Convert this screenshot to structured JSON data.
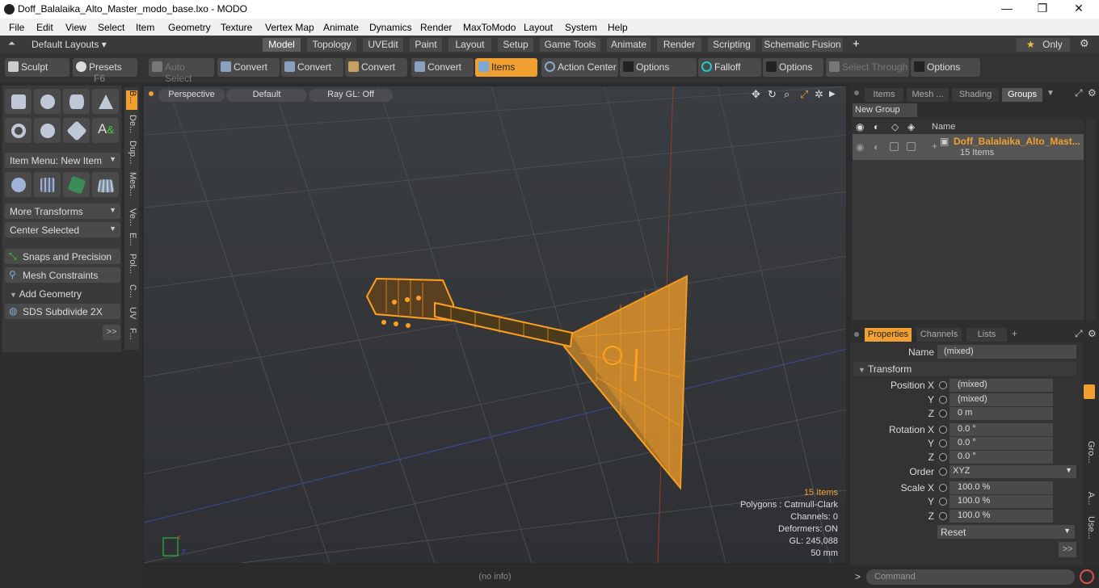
{
  "window": {
    "title": "Doff_Balalaika_Alto_Master_modo_base.lxo - MODO",
    "minimize": "—",
    "maximize": "❐",
    "close": "✕"
  },
  "menu": [
    "File",
    "Edit",
    "View",
    "Select",
    "Item",
    "Geometry",
    "Texture",
    "Vertex Map",
    "Animate",
    "Dynamics",
    "Render",
    "MaxToModo",
    "Layout",
    "System",
    "Help"
  ],
  "layouts": {
    "label": "Default Layouts ▾"
  },
  "tabs": [
    "Model",
    "Topology",
    "UVEdit",
    "Paint",
    "Layout",
    "Setup",
    "Game Tools",
    "Animate",
    "Render",
    "Scripting",
    "Schematic Fusion"
  ],
  "tab_add": "+",
  "only": "Only",
  "toolbar": {
    "sculpt": "Sculpt",
    "presets": "Presets",
    "presets_key": "F6",
    "auto_select": "Auto Select",
    "convert1": "Convert",
    "convert2": "Convert",
    "convert3": "Convert",
    "convert4": "Convert",
    "items": "Items",
    "action_center": "Action Center",
    "options1": "Options",
    "falloff": "Falloff",
    "options2": "Options",
    "select_through": "Select Through",
    "options3": "Options"
  },
  "left": {
    "item_menu": "Item Menu: New Item",
    "more_transforms": "More Transforms",
    "center_selected": "Center Selected",
    "snaps": "Snaps and Precision",
    "mesh_constraints": "Mesh Constraints",
    "add_geometry": "Add Geometry",
    "sds": "SDS Subdivide 2X",
    "more": ">>",
    "vtabs": [
      "B...",
      "De...",
      "Dup...",
      "Mes...",
      "Ve...",
      "E...",
      "Pol...",
      "C...",
      "UV",
      "F..."
    ]
  },
  "viewport": {
    "perspective": "Perspective",
    "default": "Default",
    "raygl": "Ray GL: Off",
    "stats": {
      "items": "15 Items",
      "polygons": "Polygons : Catmull-Clark",
      "channels": "Channels: 0",
      "deformers": "Deformers: ON",
      "gl": "GL: 245,088",
      "size": "50 mm"
    }
  },
  "status": "(no info)",
  "right": {
    "tabs": [
      "Items",
      "Mesh ...",
      "Shading",
      "Groups"
    ],
    "new_group": "New Group",
    "name_header": "Name",
    "group_name": "Doff_Balalaika_Alto_Mast...",
    "group_count": "15 Items",
    "ptabs": [
      "Properties",
      "Channels",
      "Lists"
    ],
    "ptab_add": "+",
    "name_label": "Name",
    "name_value": "(mixed)",
    "transform": "Transform",
    "rows": [
      {
        "label": "Position X",
        "value": "(mixed)"
      },
      {
        "label": "Y",
        "value": "(mixed)"
      },
      {
        "label": "Z",
        "value": "0 m"
      },
      {
        "label": "Rotation X",
        "value": "0.0 °"
      },
      {
        "label": "Y",
        "value": "0.0 °"
      },
      {
        "label": "Z",
        "value": "0.0 °"
      },
      {
        "label": "Order",
        "value": "XYZ"
      },
      {
        "label": "Scale X",
        "value": "100.0 %"
      },
      {
        "label": "Y",
        "value": "100.0 %"
      },
      {
        "label": "Z",
        "value": "100.0 %"
      }
    ],
    "reset": "Reset",
    "more": ">>",
    "side_tabs": [
      "Gro...",
      "A...",
      "Use..."
    ],
    "command": "Command"
  }
}
